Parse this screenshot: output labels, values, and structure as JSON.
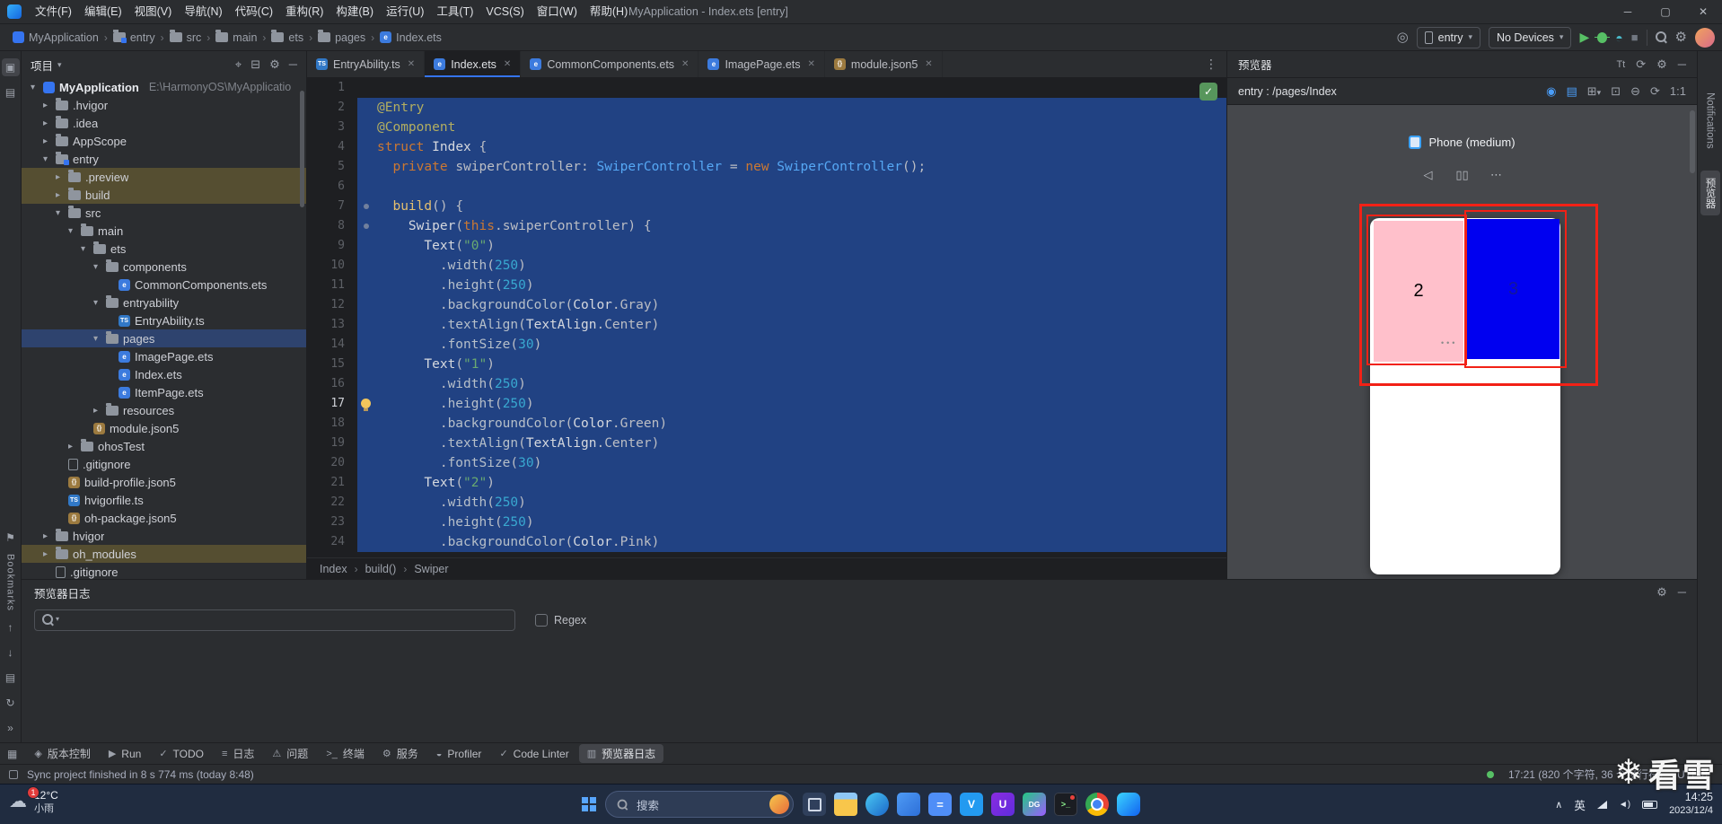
{
  "colors": {
    "accent": "#3574f0",
    "editor_selection": "#214283",
    "tree_selection": "#2e436e",
    "excluded_row": "#554e31",
    "overlay_red": "#f22116",
    "pink_block": "#ffc0cb",
    "blue_block": "#0000f0"
  },
  "titlebar": {
    "title": "MyApplication - Index.ets [entry]",
    "menus": [
      "文件(F)",
      "编辑(E)",
      "视图(V)",
      "导航(N)",
      "代码(C)",
      "重构(R)",
      "构建(B)",
      "运行(U)",
      "工具(T)",
      "VCS(S)",
      "窗口(W)",
      "帮助(H)"
    ]
  },
  "navbar": {
    "breadcrumbs": [
      {
        "label": "MyApplication",
        "icon": "project"
      },
      {
        "label": "entry",
        "icon": "module"
      },
      {
        "label": "src",
        "icon": "folder"
      },
      {
        "label": "main",
        "icon": "folder"
      },
      {
        "label": "ets",
        "icon": "folder"
      },
      {
        "label": "pages",
        "icon": "folder"
      },
      {
        "label": "Index.ets",
        "icon": "ets"
      }
    ],
    "run_config": "entry",
    "device": "No Devices"
  },
  "project_panel": {
    "title": "项目",
    "tree": [
      {
        "label": "MyApplication",
        "hint": "E:\\HarmonyOS\\MyApplicatio",
        "indent": 0,
        "chev": "open",
        "icon": "project"
      },
      {
        "label": ".hvigor",
        "indent": 1,
        "chev": "closed",
        "icon": "folder"
      },
      {
        "label": ".idea",
        "indent": 1,
        "chev": "closed",
        "icon": "folder"
      },
      {
        "label": "AppScope",
        "indent": 1,
        "chev": "closed",
        "icon": "folder"
      },
      {
        "label": "entry",
        "indent": 1,
        "chev": "open",
        "icon": "module"
      },
      {
        "label": ".preview",
        "indent": 2,
        "chev": "closed",
        "icon": "folder",
        "row": "excluded"
      },
      {
        "label": "build",
        "indent": 2,
        "chev": "closed",
        "icon": "folder",
        "row": "excluded"
      },
      {
        "label": "src",
        "indent": 2,
        "chev": "open",
        "icon": "folder"
      },
      {
        "label": "main",
        "indent": 3,
        "chev": "open",
        "icon": "folder"
      },
      {
        "label": "ets",
        "indent": 4,
        "chev": "open",
        "icon": "folder"
      },
      {
        "label": "components",
        "indent": 5,
        "chev": "open",
        "icon": "folder"
      },
      {
        "label": "CommonComponents.ets",
        "indent": 6,
        "icon": "ets"
      },
      {
        "label": "entryability",
        "indent": 5,
        "chev": "open",
        "icon": "folder"
      },
      {
        "label": "EntryAbility.ts",
        "indent": 6,
        "icon": "ts"
      },
      {
        "label": "pages",
        "indent": 5,
        "chev": "open",
        "icon": "folder",
        "row": "selected"
      },
      {
        "label": "ImagePage.ets",
        "indent": 6,
        "icon": "ets"
      },
      {
        "label": "Index.ets",
        "indent": 6,
        "icon": "ets"
      },
      {
        "label": "ItemPage.ets",
        "indent": 6,
        "icon": "ets"
      },
      {
        "label": "resources",
        "indent": 5,
        "chev": "closed",
        "icon": "folder"
      },
      {
        "label": "module.json5",
        "indent": 4,
        "icon": "json"
      },
      {
        "label": "ohosTest",
        "indent": 3,
        "chev": "closed",
        "icon": "folder"
      },
      {
        "label": ".gitignore",
        "indent": 2,
        "icon": "file"
      },
      {
        "label": "build-profile.json5",
        "indent": 2,
        "icon": "json"
      },
      {
        "label": "hvigorfile.ts",
        "indent": 2,
        "icon": "ts"
      },
      {
        "label": "oh-package.json5",
        "indent": 2,
        "icon": "json"
      },
      {
        "label": "hvigor",
        "indent": 1,
        "chev": "closed",
        "icon": "folder"
      },
      {
        "label": "oh_modules",
        "indent": 1,
        "chev": "closed",
        "icon": "folder",
        "row": "excluded"
      },
      {
        "label": ".gitignore",
        "indent": 1,
        "icon": "file"
      }
    ]
  },
  "tabs": [
    {
      "label": "EntryAbility.ts",
      "icon": "ts"
    },
    {
      "label": "Index.ets",
      "icon": "ets",
      "active": true
    },
    {
      "label": "CommonComponents.ets",
      "icon": "ets"
    },
    {
      "label": "ImagePage.ets",
      "icon": "ets"
    },
    {
      "label": "module.json5",
      "icon": "json"
    }
  ],
  "editor": {
    "current_line": 17,
    "breadcrumb": [
      "Index",
      "build()",
      "Swiper"
    ],
    "lines": [
      {
        "n": 1,
        "sel": false,
        "t": []
      },
      {
        "n": 2,
        "sel": true,
        "t": [
          [
            "a",
            "@Entry"
          ]
        ]
      },
      {
        "n": 3,
        "sel": true,
        "t": [
          [
            "a",
            "@Component"
          ]
        ]
      },
      {
        "n": 4,
        "sel": true,
        "t": [
          [
            "k",
            "struct"
          ],
          [
            "p",
            " "
          ],
          [
            "cp",
            "Index"
          ],
          [
            "p",
            " {"
          ]
        ]
      },
      {
        "n": 5,
        "sel": true,
        "t": [
          [
            "p",
            "  "
          ],
          [
            "k",
            "private"
          ],
          [
            "p",
            " "
          ],
          [
            "fl",
            "swiperController"
          ],
          [
            "p",
            ": "
          ],
          [
            "ty",
            "SwiperController"
          ],
          [
            "p",
            " = "
          ],
          [
            "k",
            "new"
          ],
          [
            "p",
            " "
          ],
          [
            "ty",
            "SwiperController"
          ],
          [
            "p",
            "();"
          ]
        ]
      },
      {
        "n": 6,
        "sel": true,
        "t": []
      },
      {
        "n": 7,
        "sel": true,
        "dot": true,
        "t": [
          [
            "p",
            "  "
          ],
          [
            "fn",
            "build"
          ],
          [
            "p",
            "() {"
          ]
        ]
      },
      {
        "n": 8,
        "sel": true,
        "dot": true,
        "t": [
          [
            "p",
            "    "
          ],
          [
            "cp",
            "Swiper"
          ],
          [
            "p",
            "("
          ],
          [
            "k",
            "this"
          ],
          [
            "p",
            "."
          ],
          [
            "fl",
            "swiperController"
          ],
          [
            "p",
            ") {"
          ]
        ]
      },
      {
        "n": 9,
        "sel": true,
        "t": [
          [
            "p",
            "      "
          ],
          [
            "cp",
            "Text"
          ],
          [
            "p",
            "("
          ],
          [
            "s",
            "\"0\""
          ],
          [
            "p",
            ")"
          ]
        ]
      },
      {
        "n": 10,
        "sel": true,
        "t": [
          [
            "p",
            "        ."
          ],
          [
            "m",
            "width"
          ],
          [
            "p",
            "("
          ],
          [
            "nu",
            "250"
          ],
          [
            "p",
            ")"
          ]
        ]
      },
      {
        "n": 11,
        "sel": true,
        "t": [
          [
            "p",
            "        ."
          ],
          [
            "m",
            "height"
          ],
          [
            "p",
            "("
          ],
          [
            "nu",
            "250"
          ],
          [
            "p",
            ")"
          ]
        ]
      },
      {
        "n": 12,
        "sel": true,
        "t": [
          [
            "p",
            "        ."
          ],
          [
            "m",
            "backgroundColor"
          ],
          [
            "p",
            "("
          ],
          [
            "cp",
            "Color"
          ],
          [
            "p",
            "."
          ],
          [
            "fl",
            "Gray"
          ],
          [
            "p",
            ")"
          ]
        ]
      },
      {
        "n": 13,
        "sel": true,
        "t": [
          [
            "p",
            "        ."
          ],
          [
            "m",
            "textAlign"
          ],
          [
            "p",
            "("
          ],
          [
            "cp",
            "TextAlign"
          ],
          [
            "p",
            "."
          ],
          [
            "fl",
            "Center"
          ],
          [
            "p",
            ")"
          ]
        ]
      },
      {
        "n": 14,
        "sel": true,
        "t": [
          [
            "p",
            "        ."
          ],
          [
            "m",
            "fontSize"
          ],
          [
            "p",
            "("
          ],
          [
            "nu",
            "30"
          ],
          [
            "p",
            ")"
          ]
        ]
      },
      {
        "n": 15,
        "sel": true,
        "t": [
          [
            "p",
            "      "
          ],
          [
            "cp",
            "Text"
          ],
          [
            "p",
            "("
          ],
          [
            "s",
            "\"1\""
          ],
          [
            "p",
            ")"
          ]
        ]
      },
      {
        "n": 16,
        "sel": true,
        "t": [
          [
            "p",
            "        ."
          ],
          [
            "m",
            "width"
          ],
          [
            "p",
            "("
          ],
          [
            "nu",
            "250"
          ],
          [
            "p",
            ")"
          ]
        ]
      },
      {
        "n": 17,
        "sel": true,
        "bulb": true,
        "t": [
          [
            "p",
            "        ."
          ],
          [
            "m",
            "height"
          ],
          [
            "p",
            "("
          ],
          [
            "nu",
            "250"
          ],
          [
            "p",
            ")"
          ]
        ]
      },
      {
        "n": 18,
        "sel": true,
        "t": [
          [
            "p",
            "        ."
          ],
          [
            "m",
            "backgroundColor"
          ],
          [
            "p",
            "("
          ],
          [
            "cp",
            "Color"
          ],
          [
            "p",
            "."
          ],
          [
            "fl",
            "Green"
          ],
          [
            "p",
            ")"
          ]
        ]
      },
      {
        "n": 19,
        "sel": true,
        "t": [
          [
            "p",
            "        ."
          ],
          [
            "m",
            "textAlign"
          ],
          [
            "p",
            "("
          ],
          [
            "cp",
            "TextAlign"
          ],
          [
            "p",
            "."
          ],
          [
            "fl",
            "Center"
          ],
          [
            "p",
            ")"
          ]
        ]
      },
      {
        "n": 20,
        "sel": true,
        "t": [
          [
            "p",
            "        ."
          ],
          [
            "m",
            "fontSize"
          ],
          [
            "p",
            "("
          ],
          [
            "nu",
            "30"
          ],
          [
            "p",
            ")"
          ]
        ]
      },
      {
        "n": 21,
        "sel": true,
        "t": [
          [
            "p",
            "      "
          ],
          [
            "cp",
            "Text"
          ],
          [
            "p",
            "("
          ],
          [
            "s",
            "\"2\""
          ],
          [
            "p",
            ")"
          ]
        ]
      },
      {
        "n": 22,
        "sel": true,
        "t": [
          [
            "p",
            "        ."
          ],
          [
            "m",
            "width"
          ],
          [
            "p",
            "("
          ],
          [
            "nu",
            "250"
          ],
          [
            "p",
            ")"
          ]
        ]
      },
      {
        "n": 23,
        "sel": true,
        "t": [
          [
            "p",
            "        ."
          ],
          [
            "m",
            "height"
          ],
          [
            "p",
            "("
          ],
          [
            "nu",
            "250"
          ],
          [
            "p",
            ")"
          ]
        ]
      },
      {
        "n": 24,
        "sel": true,
        "t": [
          [
            "p",
            "        ."
          ],
          [
            "m",
            "backgroundColor"
          ],
          [
            "p",
            "("
          ],
          [
            "cp",
            "Color"
          ],
          [
            "p",
            "."
          ],
          [
            "fl",
            "Pink"
          ],
          [
            "p",
            ")"
          ]
        ]
      }
    ]
  },
  "previewer": {
    "title": "预览器",
    "route": "entry : /pages/Index",
    "zoom_label": "1:1",
    "device_label": "Phone (medium)",
    "swiper_left_text": "2",
    "swiper_right_text": "3"
  },
  "log_panel": {
    "title": "预览器日志",
    "regex_label": "Regex"
  },
  "toolwindow_bar": {
    "items": [
      {
        "label": "版本控制",
        "icon": "branch"
      },
      {
        "label": "Run",
        "icon": "run"
      },
      {
        "label": "TODO",
        "icon": "todo"
      },
      {
        "label": "日志",
        "icon": "log"
      },
      {
        "label": "问题",
        "icon": "problems"
      },
      {
        "label": "终端",
        "icon": "terminal"
      },
      {
        "label": "服务",
        "icon": "services"
      },
      {
        "label": "Profiler",
        "icon": "profiler"
      },
      {
        "label": "Code Linter",
        "icon": "linter"
      },
      {
        "label": "预览器日志",
        "icon": "preview-log",
        "active": true
      }
    ]
  },
  "statusbar": {
    "message": "Sync project finished in 8 s 774 ms (today 8:48)",
    "caret_info": "17:21 (820 个字符, 36 个换行符)",
    "encoding": "UTF-8"
  },
  "left_strip": {
    "bookmarks_label": "Bookmarks"
  },
  "right_strip": {
    "items": [
      "Notifications",
      "预览器"
    ]
  },
  "taskbar": {
    "weather_temp": "12°C",
    "weather_desc": "小雨",
    "badge": "1",
    "search_label": "搜索",
    "ime": "英",
    "time": "14:25",
    "date": "2023/12/4",
    "apps": [
      "task-view",
      "file-explorer",
      "edge",
      "mail",
      "calculator",
      "vscode",
      "uibot",
      "datagrip",
      "terminal",
      "chrome",
      "deveco-studio"
    ]
  },
  "watermark": {
    "text": "看雪"
  },
  "icons": {
    "search": "magnifier",
    "settings": "gear",
    "more_vertical": "⋮",
    "refresh": "⟳",
    "collapse_all": "⊟",
    "locate": "⌖"
  }
}
